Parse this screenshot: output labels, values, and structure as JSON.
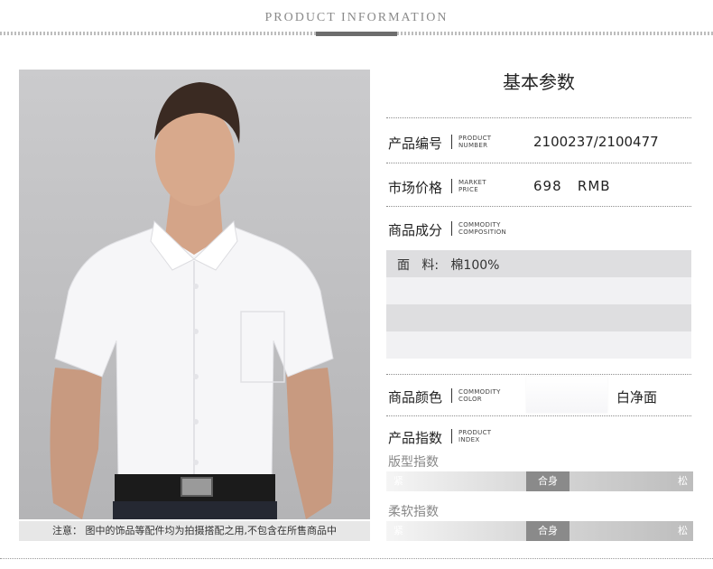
{
  "header": {
    "title": "PRODUCT INFORMATION"
  },
  "photo": {
    "notice": "注意： 图中的饰品等配件均为拍摄搭配之用,不包含在所售商品中"
  },
  "params": {
    "title": "基本参数",
    "product_number": {
      "label_cn": "产品编号",
      "label_en_1": "PRODUCT",
      "label_en_2": "NUMBER",
      "value": "2100237/2100477"
    },
    "market_price": {
      "label_cn": "市场价格",
      "label_en_1": "MARKET",
      "label_en_2": "PRICE",
      "value": "698   RMB"
    },
    "composition": {
      "label_cn": "商品成分",
      "label_en_1": "COMMODITY",
      "label_en_2": "COMPOSITION",
      "rows": [
        "面   料:   棉100%",
        "",
        "",
        ""
      ],
      "row_colors": [
        "#dedee0",
        "#f1f1f3",
        "#dedee0",
        "#f1f1f3"
      ]
    },
    "color": {
      "label_cn": "商品颜色",
      "label_en_1": "COMMODITY",
      "label_en_2": "COLOR",
      "value": "白净面"
    },
    "index": {
      "label_cn": "产品指数",
      "label_en_1": "PRODUCT",
      "label_en_2": "INDEX",
      "fit": {
        "label": "版型指数",
        "left": "紧",
        "middle": "合身",
        "right": "松"
      },
      "softness": {
        "label": "柔软指数",
        "left": "紧",
        "middle": "合身",
        "right": "松"
      }
    }
  }
}
